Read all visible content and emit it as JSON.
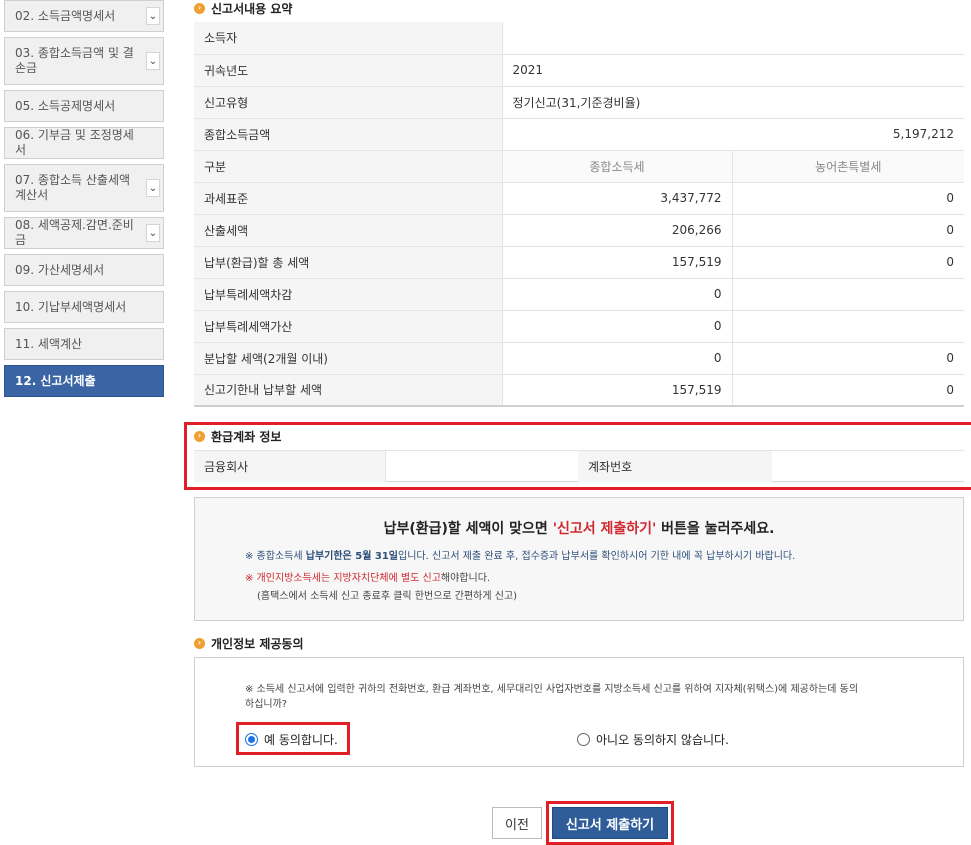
{
  "sidebar": {
    "items": [
      {
        "label": "02. 소득금액명세서",
        "chevron": true
      },
      {
        "label": "03. 종합소득금액 및 결손금",
        "chevron": true
      },
      {
        "label": "05. 소득공제명세서",
        "chevron": false
      },
      {
        "label": "06. 기부금 및 조정명세서",
        "chevron": false
      },
      {
        "label": "07. 종합소득 산출세액계산서",
        "chevron": true
      },
      {
        "label": "08. 세액공제.감면.준비금",
        "chevron": true
      },
      {
        "label": "09. 가산세명세서",
        "chevron": false
      },
      {
        "label": "10. 기납부세액명세서",
        "chevron": false
      },
      {
        "label": "11. 세액계산",
        "chevron": false
      },
      {
        "label": "12. 신고서제출",
        "chevron": false,
        "active": true
      }
    ],
    "chevron_glyph": "⌄"
  },
  "summary": {
    "title": "신고서내용 요약",
    "rows": [
      {
        "label": "소득자",
        "value": ""
      },
      {
        "label": "귀속년도",
        "value": "2021"
      },
      {
        "label": "신고유형",
        "value": "정기신고(31,기준경비율)"
      },
      {
        "label": "종합소득금액",
        "value": "5,197,212"
      }
    ],
    "col_header_label": "구분",
    "col1": "종합소득세",
    "col2": "농어촌특별세",
    "tax_rows": [
      {
        "label": "과세표준",
        "v1": "3,437,772",
        "v2": "0"
      },
      {
        "label": "산출세액",
        "v1": "206,266",
        "v2": "0"
      },
      {
        "label": "납부(환급)할 총 세액",
        "v1": "157,519",
        "v2": "0"
      },
      {
        "label": "납부특례세액차감",
        "v1": "0",
        "v2": ""
      },
      {
        "label": "납부특례세액가산",
        "v1": "0",
        "v2": ""
      },
      {
        "label": "분납할 세액(2개월 이내)",
        "v1": "0",
        "v2": "0"
      },
      {
        "label": "신고기한내 납부할 세액",
        "v1": "157,519",
        "v2": "0"
      }
    ]
  },
  "refund": {
    "title": "환급계좌 정보",
    "bank_label": "금융회사",
    "bank_value": "",
    "account_label": "계좌번호",
    "account_value": ""
  },
  "notice": {
    "msg_pre": "납부(환급)할 세액이 맞으면 ",
    "msg_red": "'신고서 제출하기'",
    "msg_post": " 버튼을 눌러주세요.",
    "line1_pre": "※ 종합소득세 ",
    "line1_bold": "납부기한은 5월 31일",
    "line1_post": "입니다. 신고서 제출 완료 후, 접수증과 납부서를 확인하시어 기한 내에 꼭 납부하시기 바랍니다.",
    "line2_red": "※ 개인지방소득세는 지방자치단체에 별도 신고",
    "line2_post": "해야합니다.",
    "line3": "(홈택스에서 소득세 신고 종료후 클릭 한번으로 간편하게 신고)"
  },
  "consent": {
    "title": "개인정보 제공동의",
    "question": "※ 소득세 신고서에 입력한 귀하의 전화번호, 환급 계좌번호, 세무대리인 사업자번호를 지방소득세 신고를 위하여 지자체(위택스)에 제공하는데 동의하십니까?",
    "yes_label": "예 동의합니다.",
    "no_label": "아니오 동의하지 않습니다.",
    "selected": "yes"
  },
  "buttons": {
    "prev": "이전",
    "submit": "신고서 제출하기"
  },
  "colors": {
    "highlight": "#e01f26",
    "active_nav": "#3a64a4",
    "submit_btn": "#2f5d9a"
  }
}
